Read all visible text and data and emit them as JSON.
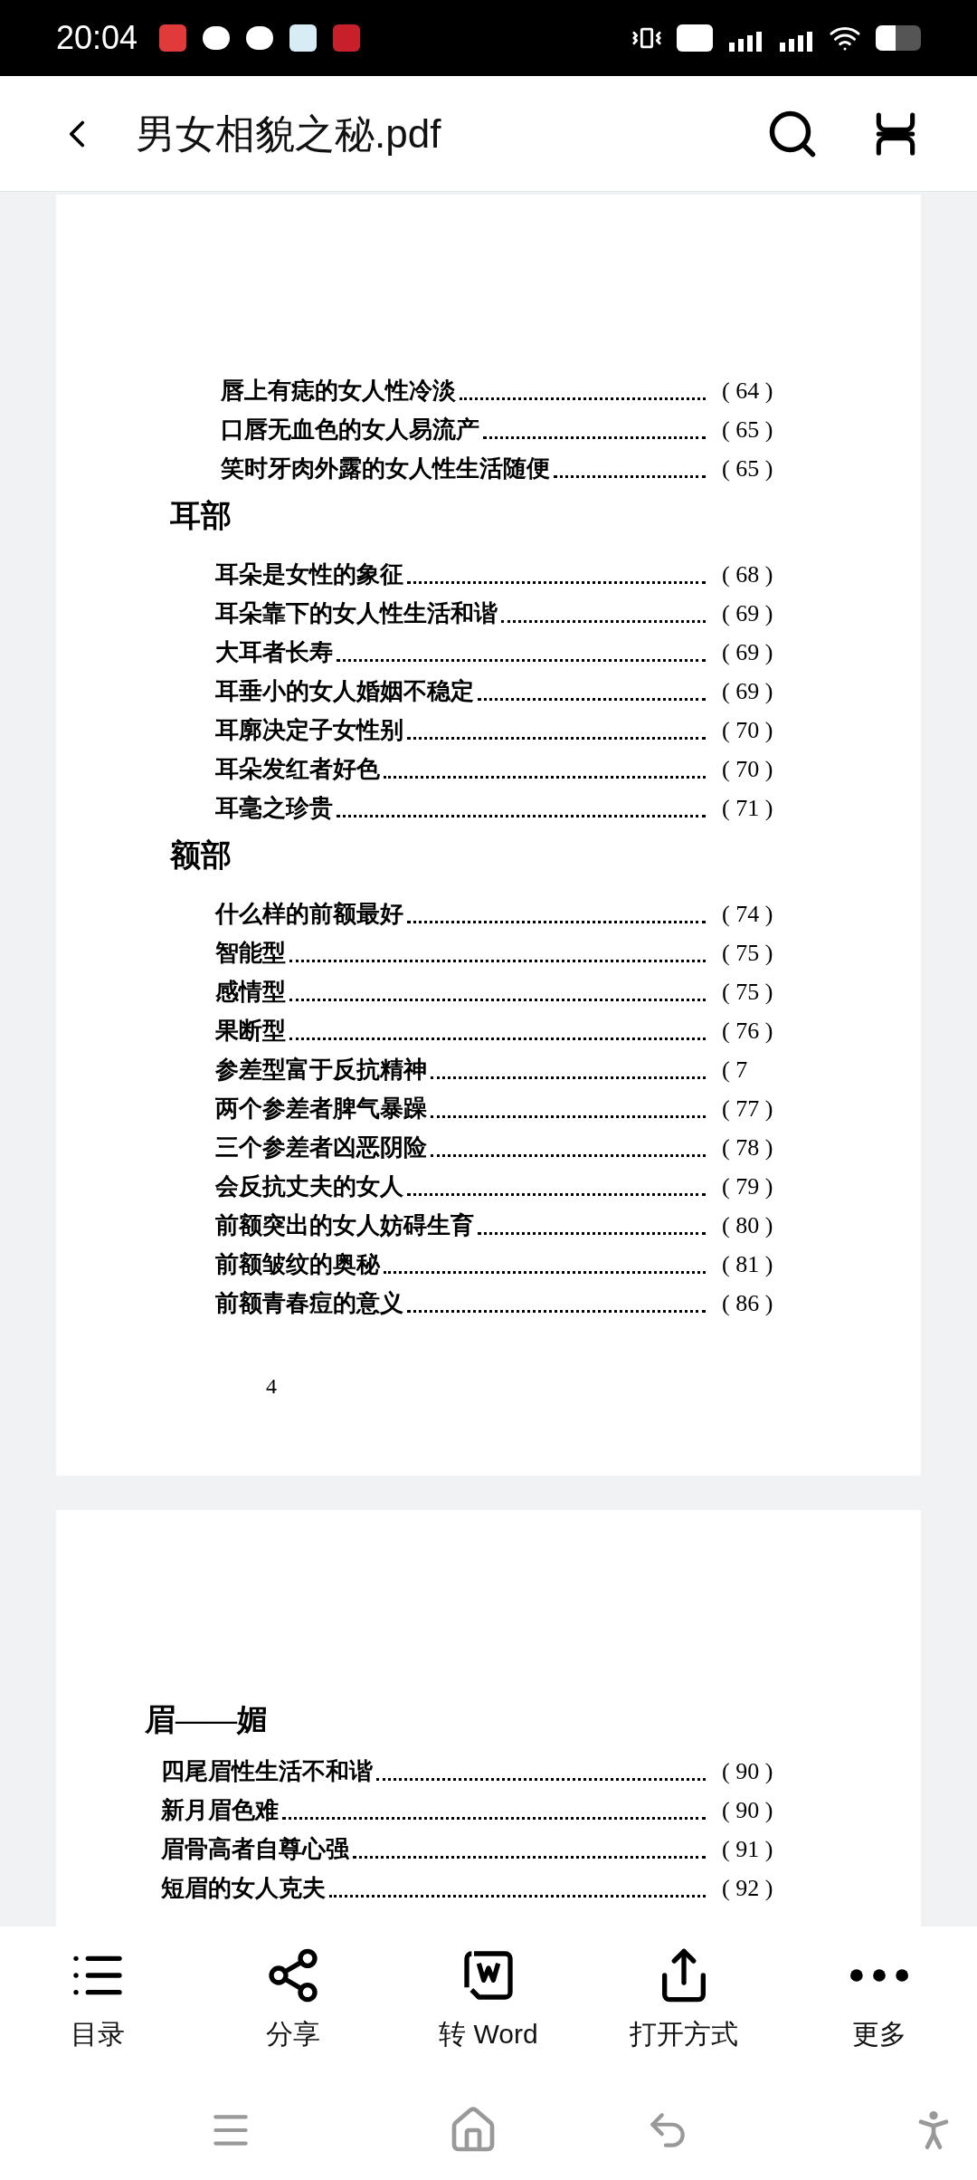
{
  "status_bar": {
    "time": "20:04"
  },
  "header": {
    "title": "男女相貌之秘.pdf"
  },
  "pages": [
    {
      "sections": [
        {
          "entries": [
            {
              "title": "唇上有痣的女人性冷淡",
              "page": "( 64 )"
            },
            {
              "title": "口唇无血色的女人易流产",
              "page": "( 65 )"
            },
            {
              "title": "笑时牙肉外露的女人性生活随便",
              "page": "( 65 )"
            }
          ]
        },
        {
          "heading": "耳部",
          "entries": [
            {
              "title": "耳朵是女性的象征",
              "page": "( 68 )"
            },
            {
              "title": "耳朵靠下的女人性生活和谐",
              "page": "( 69 )"
            },
            {
              "title": "大耳者长寿",
              "page": "( 69 )"
            },
            {
              "title": "耳垂小的女人婚姻不稳定",
              "page": "( 69 )"
            },
            {
              "title": "耳廓决定子女性别",
              "page": "( 70 )"
            },
            {
              "title": "耳朵发红者好色",
              "page": "( 70 )"
            },
            {
              "title": "耳毫之珍贵",
              "page": "( 71 )"
            }
          ]
        },
        {
          "heading": "额部",
          "entries": [
            {
              "title": "什么样的前额最好",
              "page": "( 74 )"
            },
            {
              "title": "智能型",
              "page": "( 75 )"
            },
            {
              "title": "感情型",
              "page": "( 75 )"
            },
            {
              "title": "果断型",
              "page": "( 76 )"
            },
            {
              "title": "参差型富于反抗精神",
              "page": "( 7"
            },
            {
              "title": "两个参差者脾气暴躁",
              "page": "( 77 )"
            },
            {
              "title": "三个参差者凶恶阴险",
              "page": "( 78 )"
            },
            {
              "title": "会反抗丈夫的女人",
              "page": "( 79 )"
            },
            {
              "title": "前额突出的女人妨碍生育",
              "page": "( 80 )"
            },
            {
              "title": "前额皱纹的奥秘",
              "page": "( 81 )"
            },
            {
              "title": "前额青春痘的意义",
              "page": "( 86 )"
            }
          ]
        }
      ],
      "footer_number": "4"
    },
    {
      "sections": [
        {
          "heading": "眉——媚",
          "entries": [
            {
              "title": "四尾眉性生活不和谐",
              "page": "( 90 )"
            },
            {
              "title": "新月眉色难",
              "page": "( 90 )"
            },
            {
              "title": "眉骨高者自尊心强",
              "page": "( 91 )"
            },
            {
              "title": "短眉的女人克夫",
              "page": "( 92 )"
            }
          ]
        }
      ]
    }
  ],
  "toolbar": [
    {
      "label": "目录"
    },
    {
      "label": "分享"
    },
    {
      "label": "转 Word"
    },
    {
      "label": "打开方式"
    },
    {
      "label": "更多"
    }
  ]
}
